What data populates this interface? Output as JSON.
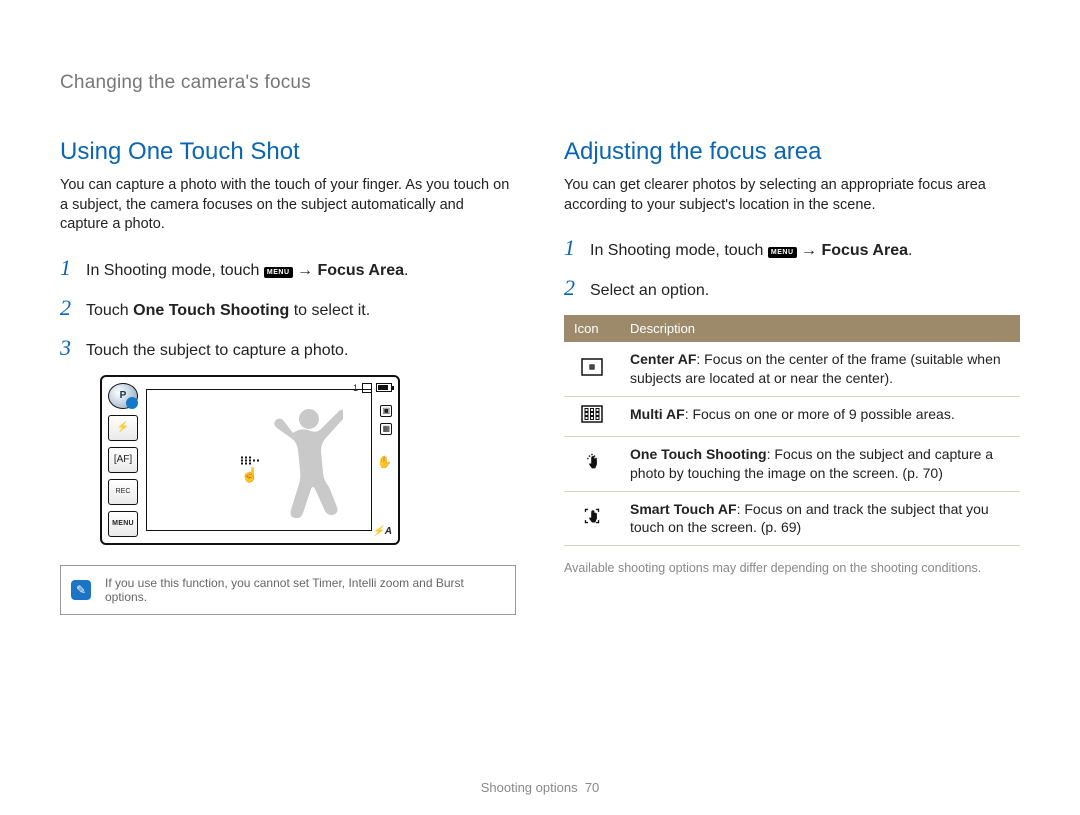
{
  "section_title": "Changing the camera's focus",
  "left": {
    "heading": "Using One Touch Shot",
    "intro": "You can capture a photo with the touch of your finger. As you touch on a subject, the camera focuses on the subject automatically and capture a photo.",
    "step1_pre": "In Shooting mode, touch ",
    "menu_label": "MENU",
    "arrow": " → ",
    "focus_area": "Focus Area",
    "step1_post": ".",
    "step2_pre": "Touch ",
    "step2_bold": "One Touch Shooting",
    "step2_post": " to select it.",
    "step3": "Touch the subject to capture a photo.",
    "cam": {
      "mode_letter": "P",
      "btn_flash": "⚡",
      "btn_af": "[AF]",
      "btn_rec": "REC",
      "menu": "MENU",
      "count": "1",
      "badge1": "▣",
      "badge2": "▦",
      "hand": "✋",
      "flash_mode": "⚡A"
    },
    "note_text": "If you use this function, you cannot set Timer, Intelli zoom and Burst options."
  },
  "right": {
    "heading": "Adjusting the focus area",
    "intro": "You can get clearer photos by selecting an appropriate focus area according to your subject's location in the scene.",
    "step1_pre": "In Shooting mode, touch ",
    "menu_label": "MENU",
    "arrow": " → ",
    "focus_area": "Focus Area",
    "step1_post": ".",
    "step2": "Select an option.",
    "table": {
      "h_icon": "Icon",
      "h_desc": "Description",
      "rows": [
        {
          "bold": "Center AF",
          "rest": ": Focus on the center of the frame (suitable when subjects are located at or near the center)."
        },
        {
          "bold": "Multi AF",
          "rest": ": Focus on one or more of 9 possible areas."
        },
        {
          "bold": "One Touch Shooting",
          "rest": ": Focus on the subject and capture a photo by touching the image on the screen. (p. 70)"
        },
        {
          "bold": "Smart Touch AF",
          "rest": ": Focus on and track the subject that you touch on the screen. (p. 69)"
        }
      ]
    },
    "footnote": "Available shooting options may differ depending on the shooting conditions."
  },
  "footer": {
    "label": "Shooting options",
    "page": "70"
  }
}
